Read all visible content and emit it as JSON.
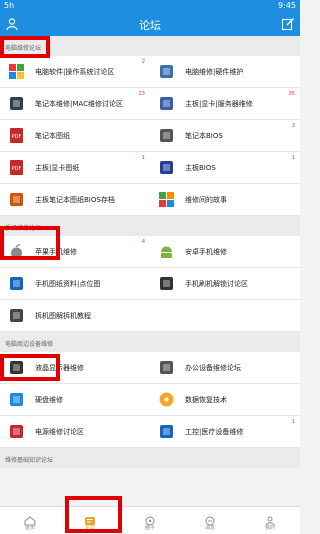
{
  "status": {
    "left": "5h",
    "time": "9:45"
  },
  "header": {
    "title": "论坛"
  },
  "sections": [
    {
      "title": "电脑维修论坛",
      "rows": [
        [
          {
            "label": "电脑软件|操作系统讨论区",
            "count": "2",
            "icon": "windows-icon",
            "color": "#2a7de1"
          },
          {
            "label": "电脑维修|硬件维护",
            "count": "",
            "icon": "pc-icon",
            "color": "#3a6fb0"
          }
        ],
        [
          {
            "label": "笔记本维修|MAC维修讨论区",
            "count": "23",
            "icon": "laptop-icon",
            "color": "#2c3e50"
          },
          {
            "label": "主板|显卡|服务器维修",
            "count": "35",
            "icon": "server-icon",
            "color": "#3a5fa8"
          }
        ],
        [
          {
            "label": "笔记本图纸",
            "count": "",
            "icon": "pdf-icon",
            "color": "#c62828"
          },
          {
            "label": "笔记本BIOS",
            "count": "3",
            "icon": "chip-icon",
            "color": "#555555"
          }
        ],
        [
          {
            "label": "主板|显卡图纸",
            "count": "1",
            "icon": "pdf-icon",
            "color": "#c62828"
          },
          {
            "label": "主板BIOS",
            "count": "1",
            "icon": "bios-icon",
            "color": "#263c9a"
          }
        ],
        [
          {
            "label": "主板笔记本图纸BIOS存档",
            "count": "",
            "icon": "books-icon",
            "color": "#d35400"
          },
          {
            "label": "维修间的故事",
            "count": "",
            "icon": "story-icon",
            "color": "#2e9e5b"
          }
        ]
      ]
    },
    {
      "title": "手机维修论坛",
      "rows": [
        [
          {
            "label": "苹果手机维修",
            "count": "4",
            "icon": "apple-icon",
            "color": "#8a8a8a"
          },
          {
            "label": "安卓手机维修",
            "count": "",
            "icon": "android-icon",
            "color": "#7cb342"
          }
        ],
        [
          {
            "label": "手机图纸资料|点位图",
            "count": "",
            "icon": "pin-icon",
            "color": "#1565c0"
          },
          {
            "label": "手机刷机解锁讨论区",
            "count": "",
            "icon": "phone-icon",
            "color": "#333333"
          }
        ],
        [
          {
            "label": "拆机图解拆机教程",
            "count": "",
            "icon": "parts-icon",
            "color": "#444444"
          },
          {
            "label": "",
            "count": "",
            "icon": "",
            "color": ""
          }
        ]
      ]
    },
    {
      "title": "电脑周边设备维修",
      "rows": [
        [
          {
            "label": "液晶显示器维修",
            "count": "",
            "icon": "monitor-icon",
            "color": "#333333"
          },
          {
            "label": "办公设备维修论坛",
            "count": "",
            "icon": "printer-icon",
            "color": "#555555"
          }
        ],
        [
          {
            "label": "硬盘维修",
            "count": "",
            "icon": "hdd-icon",
            "color": "#1e88e5"
          },
          {
            "label": "数据恢复技术",
            "count": "",
            "icon": "disc-icon",
            "color": "#f9a825"
          }
        ],
        [
          {
            "label": "电源维修讨论区",
            "count": "",
            "icon": "power-icon",
            "color": "#c62828"
          },
          {
            "label": "工控|医疗设备维修",
            "count": "1",
            "icon": "robot-icon",
            "color": "#1565c0"
          }
        ]
      ]
    },
    {
      "title": "维修基础知识论坛",
      "rows": []
    }
  ],
  "tabs": [
    {
      "label": "首页",
      "icon": "home-icon",
      "active": false
    },
    {
      "label": "论坛",
      "icon": "forum-icon",
      "active": true
    },
    {
      "label": "圈子",
      "icon": "circle-icon",
      "active": false
    },
    {
      "label": "消息",
      "icon": "message-icon",
      "active": false
    },
    {
      "label": "我的",
      "icon": "profile-icon",
      "active": false
    }
  ],
  "colors": {
    "accent": "#1e8fe0",
    "highlight": "#e10000",
    "active_tab": "#e8a32c"
  }
}
